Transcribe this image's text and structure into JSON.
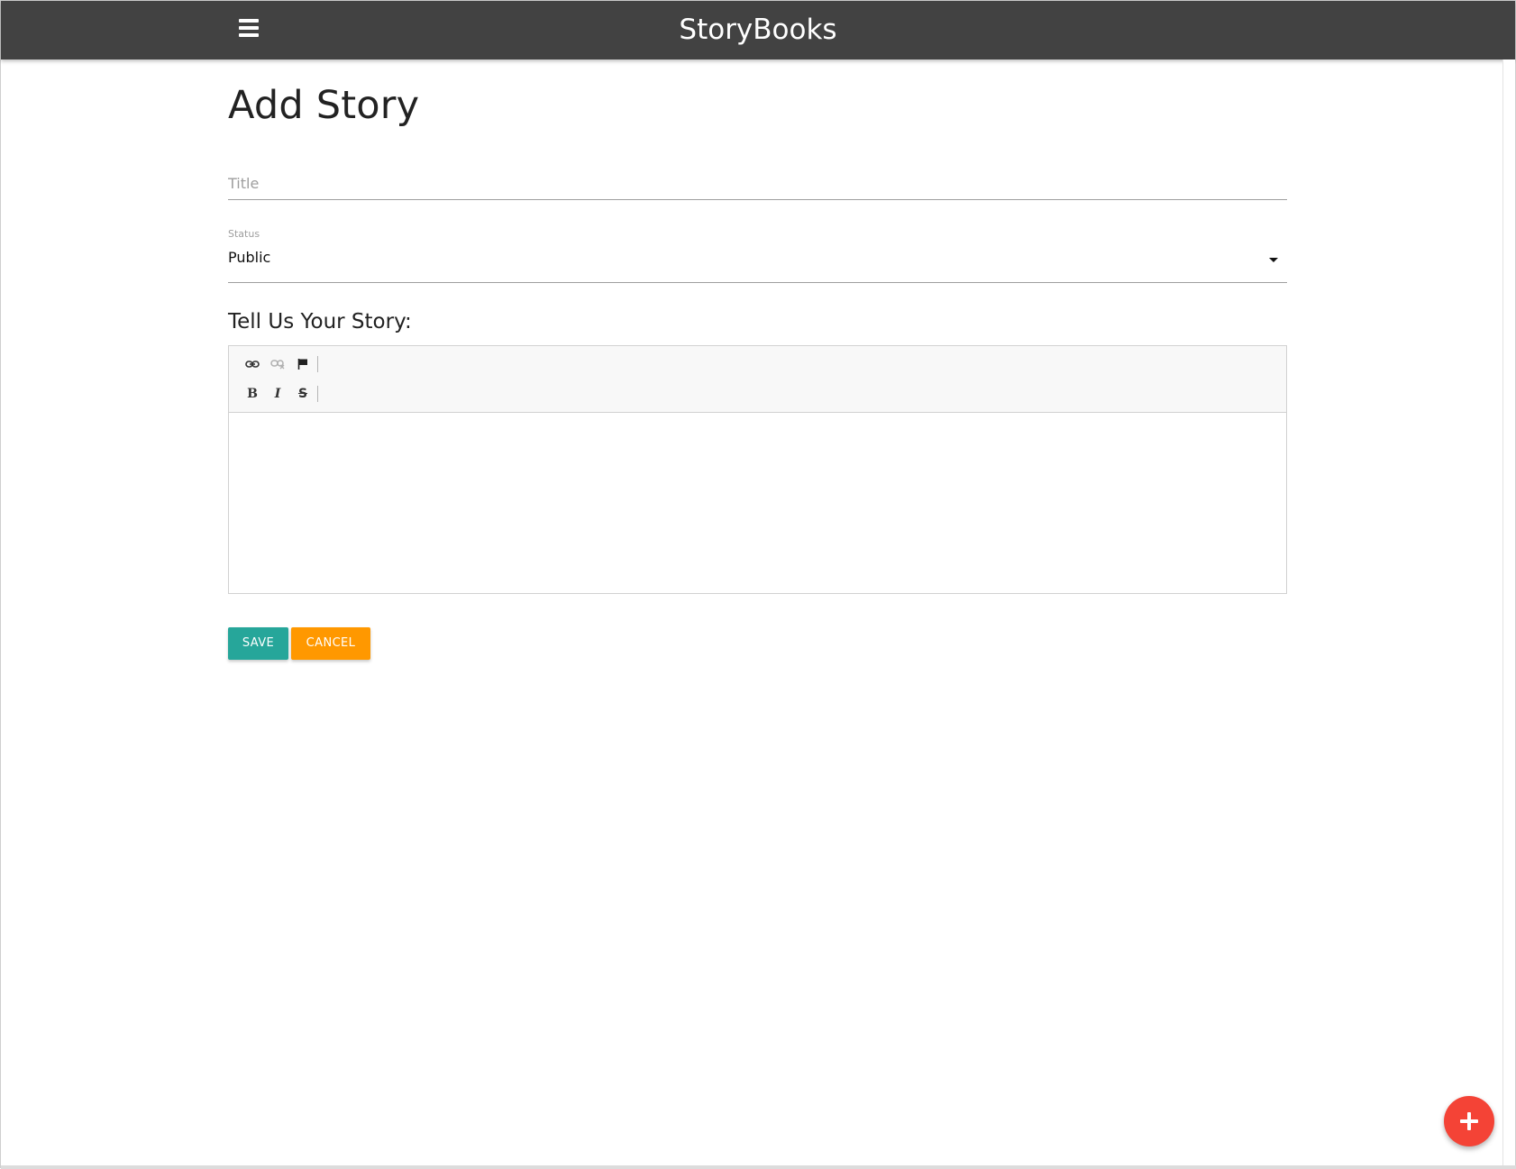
{
  "navbar": {
    "brand": "StoryBooks",
    "menu_icon": "hamburger-menu-icon",
    "background": "#424242"
  },
  "page": {
    "title": "Add Story"
  },
  "form": {
    "title_placeholder": "Title",
    "title_value": "",
    "status_label": "Status",
    "status_value": "Public",
    "story_heading": "Tell Us Your Story:"
  },
  "editor": {
    "toolbar_row1": [
      {
        "name": "link",
        "icon": "link-icon",
        "enabled": true
      },
      {
        "name": "unlink",
        "icon": "unlink-icon",
        "enabled": false
      },
      {
        "name": "anchor",
        "icon": "flag-icon",
        "enabled": true
      }
    ],
    "toolbar_row2": [
      {
        "name": "bold",
        "label": "B"
      },
      {
        "name": "italic",
        "label": "I"
      },
      {
        "name": "strike",
        "label": "S"
      }
    ],
    "content": ""
  },
  "actions": {
    "save_label": "Save",
    "cancel_label": "Cancel",
    "save_color": "#26a69a",
    "cancel_color": "#ff9800"
  },
  "fab": {
    "icon": "plus-icon",
    "color": "#f44336"
  }
}
